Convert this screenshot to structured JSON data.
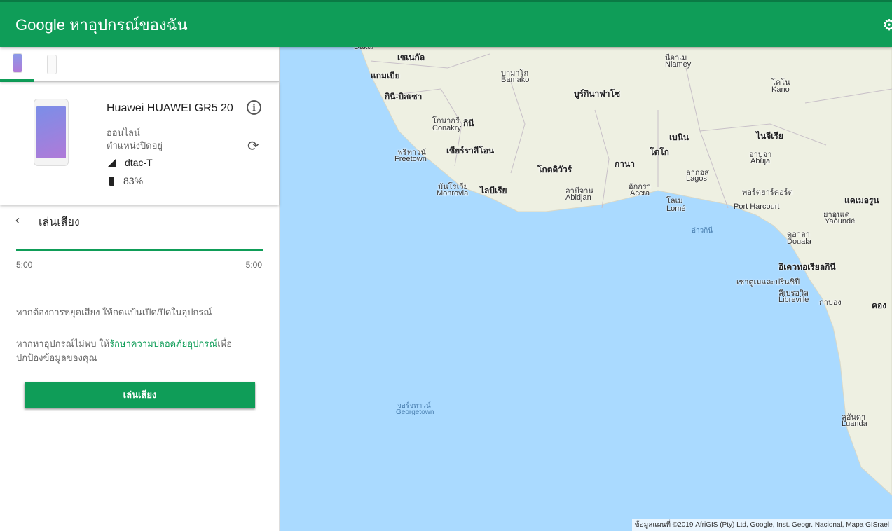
{
  "header": {
    "brand": "Google",
    "title": "หาอุปกรณ์ของฉัน",
    "settings_icon": "gear-icon"
  },
  "device": {
    "name": "Huawei HUAWEI GR5 20",
    "status": "ออนไลน์",
    "location_status": "ตำแหน่งปิดอยู่",
    "carrier": "dtac-T",
    "battery": "83%"
  },
  "sound": {
    "title": "เล่นเสียง",
    "progress_percent": 100,
    "time_start": "5:00",
    "time_end": "5:00"
  },
  "messages": {
    "stop_hint": "หากต้องการหยุดเสียง ให้กดแป้นเปิด/ปิดในอุปกรณ์",
    "not_found_pre": "หากหาอุปกรณ์ไม่พบ ให้",
    "secure_link": "รักษาความปลอดภัยอุปกรณ์",
    "not_found_post": "เพื่อปกป้องข้อมูลของคุณ"
  },
  "play_button": "เล่นเสียง",
  "map": {
    "labels": [
      "Dakar",
      "เซเนกัล",
      "แกมเบีย",
      "กินี-บิสเซา",
      "บามาโก",
      "Bamako",
      "นีอาเม",
      "Niamey",
      "โคโน",
      "Kano",
      "บูร์กินาฟาโซ",
      "โกนากรี",
      "Conakry",
      "กินี",
      "เบนิน",
      "ไนจีเรีย",
      "ฟรีทาวน์",
      "Freetown",
      "เซียร์ราลีโอน",
      "โกตดิวัวร์",
      "กานา",
      "โตโก",
      "อาบูจา",
      "Abuja",
      "ลากอส",
      "Lagos",
      "มันโรเวีย",
      "Monrovia",
      "ไลบีเรีย",
      "อาบีจาน",
      "Abidjan",
      "อักกรา",
      "Accra",
      "โลเม",
      "Lomé",
      "พอร์ตฮาร์คอร์ต",
      "Port Harcourt",
      "แคเมอรูน",
      "ยาอุนเด",
      "Yaoundé",
      "อ่าวกินี",
      "ดูอาลา",
      "Douala",
      "อิเควทอเรียลกินี",
      "เซาตูเมและปรินซิปี",
      "ลีเบรอวิล",
      "Libreville",
      "กาบอง",
      "คอง",
      "จอร์จทาวน์",
      "Georgetown",
      "ลูอันดา",
      "Luanda"
    ],
    "attribution": "ข้อมูลแผนที่ ©2019 AfriGIS (Pty) Ltd, Google, Inst. Geogr. Nacional, Mapa GISrael"
  },
  "colors": {
    "accent": "#0f9d58",
    "ocean": "#aadaff",
    "land": "#eef0e2"
  }
}
